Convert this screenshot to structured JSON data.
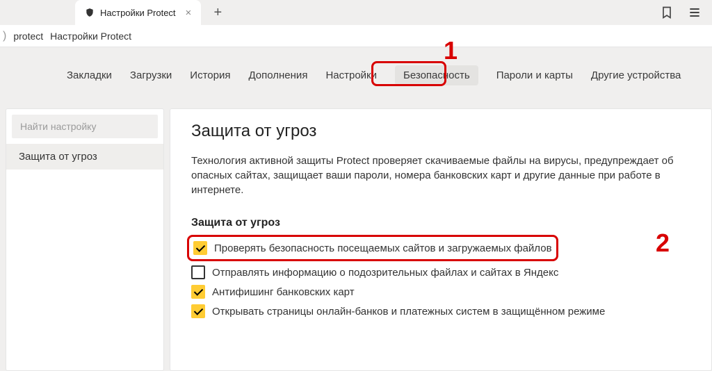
{
  "tab": {
    "title": "Настройки Protect"
  },
  "breadcrumb": {
    "part1": "protect",
    "part2": "Настройки Protect"
  },
  "nav": {
    "items": [
      "Закладки",
      "Загрузки",
      "История",
      "Дополнения",
      "Настройки",
      "Безопасность",
      "Пароли и карты",
      "Другие устройства"
    ]
  },
  "annotations": {
    "a1": "1",
    "a2": "2"
  },
  "sidebar": {
    "search_placeholder": "Найти настройку",
    "item": "Защита от угроз"
  },
  "content": {
    "heading": "Защита от угроз",
    "description": "Технология активной защиты Protect проверяет скачиваемые файлы на вирусы, предупреждает об опасных сайтах, защищает ваши пароли, номера банковских карт и другие данные при работе в интернете.",
    "subheading": "Защита от угроз",
    "options": [
      {
        "label": "Проверять безопасность посещаемых сайтов и загружаемых файлов",
        "checked": true
      },
      {
        "label": "Отправлять информацию о подозрительных файлах и сайтах в Яндекс",
        "checked": false
      },
      {
        "label": "Антифишинг банковских карт",
        "checked": true
      },
      {
        "label": "Открывать страницы онлайн-банков и платежных систем в защищённом режиме",
        "checked": true
      }
    ]
  }
}
